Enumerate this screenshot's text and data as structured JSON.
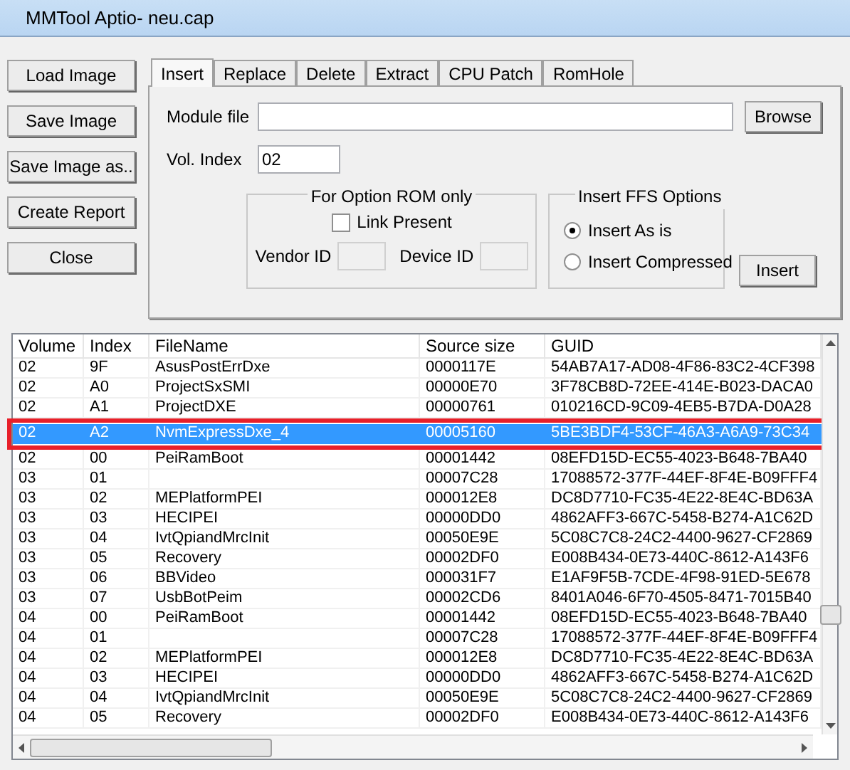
{
  "window": {
    "title": "MMTool Aptio- neu.cap"
  },
  "side_buttons": [
    "Load Image",
    "Save Image",
    "Save Image as..",
    "Create Report",
    "Close"
  ],
  "tabs": [
    {
      "label": "Insert",
      "selected": true
    },
    {
      "label": "Replace",
      "selected": false
    },
    {
      "label": "Delete",
      "selected": false
    },
    {
      "label": "Extract",
      "selected": false
    },
    {
      "label": "CPU Patch",
      "selected": false
    },
    {
      "label": "RomHole",
      "selected": false
    }
  ],
  "module_file": {
    "label": "Module file"
  },
  "browse_button": "Browse",
  "vol_index": {
    "label": "Vol. Index",
    "value": "02"
  },
  "option_rom": {
    "title": "For Option ROM only",
    "link_present": {
      "label": "Link Present",
      "checked": false
    },
    "vendor_id": {
      "label": "Vendor ID"
    },
    "device_id": {
      "label": "Device ID"
    }
  },
  "ffs_options": {
    "title": "Insert FFS Options",
    "options": [
      {
        "label": "Insert As is",
        "selected": true
      },
      {
        "label": "Insert Compressed",
        "selected": false
      }
    ]
  },
  "insert_button": "Insert",
  "table": {
    "columns": [
      "Volume",
      "Index",
      "FileName",
      "Source size",
      "GUID"
    ],
    "rows": [
      {
        "cells": [
          "02",
          "9F",
          "AsusPostErrDxe",
          "0000117E",
          "54AB7A17-AD08-4F86-83C2-4CF398"
        ],
        "selected": false
      },
      {
        "cells": [
          "02",
          "A0",
          "ProjectSxSMI",
          "00000E70",
          "3F78CB8D-72EE-414E-B023-DACA0"
        ],
        "selected": false
      },
      {
        "cells": [
          "02",
          "A1",
          "ProjectDXE",
          "00000761",
          "010216CD-9C09-4EB5-B7DA-D0A28"
        ],
        "selected": false
      },
      {
        "cells": [
          "02",
          "A2",
          "NvmExpressDxe_4",
          "00005160",
          "5BE3BDF4-53CF-46A3-A6A9-73C34"
        ],
        "selected": true
      },
      {
        "cells": [
          "02",
          "00",
          "PeiRamBoot",
          "00001442",
          "08EFD15D-EC55-4023-B648-7BA40"
        ],
        "selected": false
      },
      {
        "cells": [
          "03",
          "01",
          "",
          "00007C28",
          "17088572-377F-44EF-8F4E-B09FFF4"
        ],
        "selected": false
      },
      {
        "cells": [
          "03",
          "02",
          "MEPlatformPEI",
          "000012E8",
          "DC8D7710-FC35-4E22-8E4C-BD63A"
        ],
        "selected": false
      },
      {
        "cells": [
          "03",
          "03",
          "HECIPEI",
          "00000DD0",
          "4862AFF3-667C-5458-B274-A1C62D"
        ],
        "selected": false
      },
      {
        "cells": [
          "03",
          "04",
          "IvtQpiandMrcInit",
          "00050E9E",
          "5C08C7C8-24C2-4400-9627-CF2869"
        ],
        "selected": false
      },
      {
        "cells": [
          "03",
          "05",
          "Recovery",
          "00002DF0",
          "E008B434-0E73-440C-8612-A143F6"
        ],
        "selected": false
      },
      {
        "cells": [
          "03",
          "06",
          "BBVideo",
          "000031F7",
          "E1AF9F5B-7CDE-4F98-91ED-5E678"
        ],
        "selected": false
      },
      {
        "cells": [
          "03",
          "07",
          "UsbBotPeim",
          "00002CD6",
          "8401A046-6F70-4505-8471-7015B40"
        ],
        "selected": false
      },
      {
        "cells": [
          "04",
          "00",
          "PeiRamBoot",
          "00001442",
          "08EFD15D-EC55-4023-B648-7BA40"
        ],
        "selected": false
      },
      {
        "cells": [
          "04",
          "01",
          "",
          "00007C28",
          "17088572-377F-44EF-8F4E-B09FFF4"
        ],
        "selected": false
      },
      {
        "cells": [
          "04",
          "02",
          "MEPlatformPEI",
          "000012E8",
          "DC8D7710-FC35-4E22-8E4C-BD63A"
        ],
        "selected": false
      },
      {
        "cells": [
          "04",
          "03",
          "HECIPEI",
          "00000DD0",
          "4862AFF3-667C-5458-B274-A1C62D"
        ],
        "selected": false
      },
      {
        "cells": [
          "04",
          "04",
          "IvtQpiandMrcInit",
          "00050E9E",
          "5C08C7C8-24C2-4400-9627-CF2869"
        ],
        "selected": false
      },
      {
        "cells": [
          "04",
          "05",
          "Recovery",
          "00002DF0",
          "E008B434-0E73-440C-8612-A143F6"
        ],
        "selected": false
      }
    ]
  }
}
